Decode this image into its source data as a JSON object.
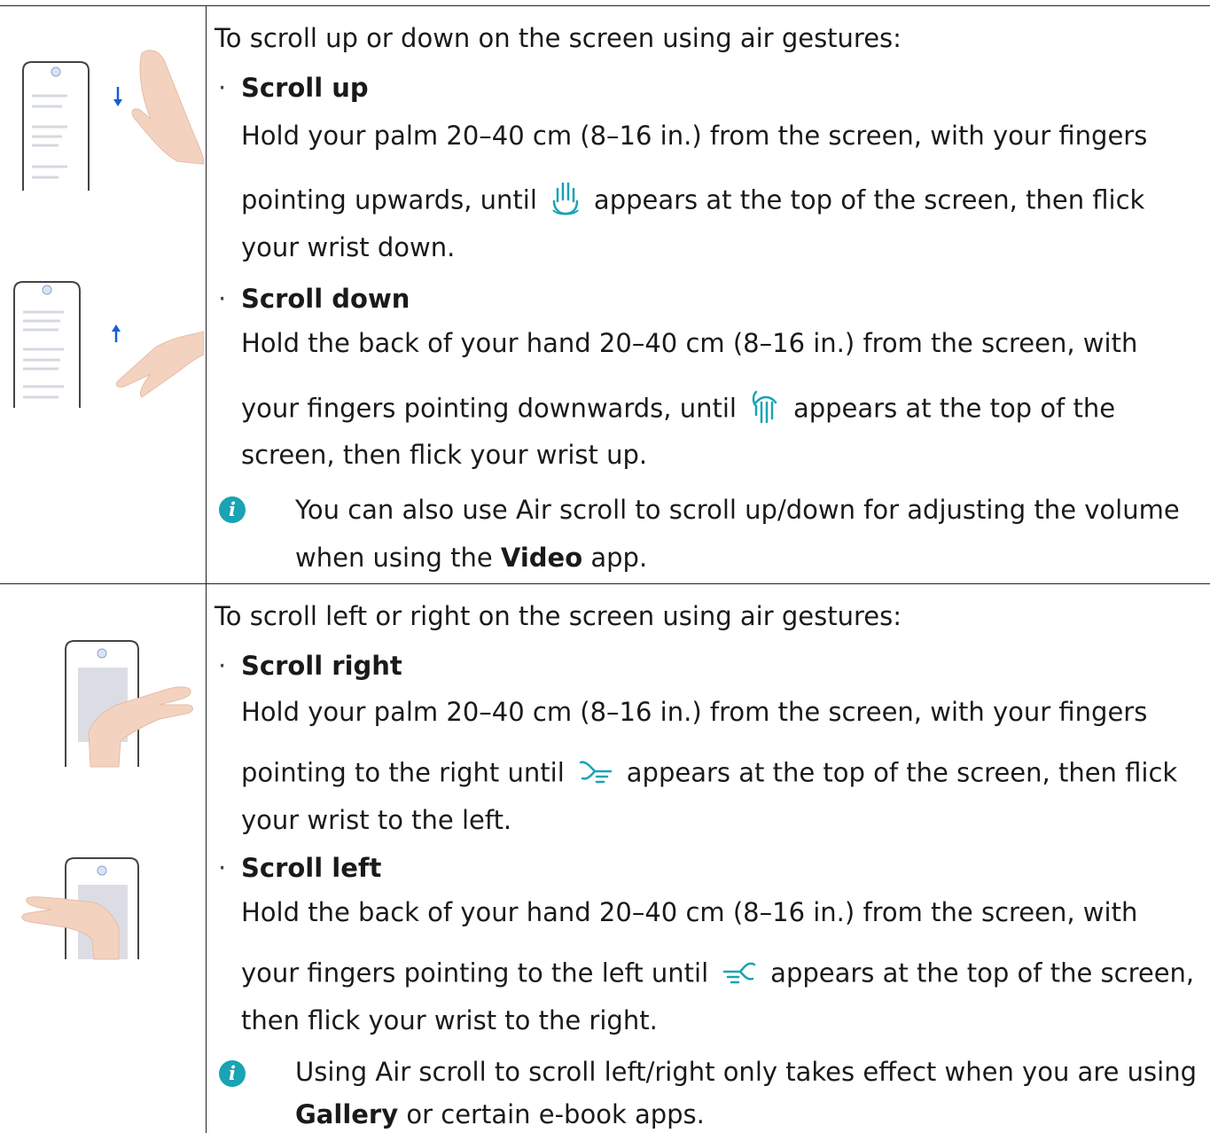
{
  "section1": {
    "intro": "To scroll up or down on the screen using air gestures:",
    "items": [
      {
        "title": "Scroll up",
        "line1": "Hold your palm 20–40 cm (8–16 in.) from the screen, with your fingers",
        "line2_pre": "pointing upwards, until",
        "line2_post": "appears at the top of the screen, then flick",
        "line3": "your wrist down.",
        "icon": "hand-palm-up-icon"
      },
      {
        "title": "Scroll down",
        "line1": "Hold the back of your hand 20–40 cm (8–16 in.) from the screen, with",
        "line2_pre": "your fingers pointing downwards, until",
        "line2_post": "appears at the top of the",
        "line3": "screen, then flick your wrist up.",
        "icon": "hand-back-down-icon"
      }
    ],
    "note": {
      "line1": "You can also use Air scroll to scroll up/down for adjusting the volume",
      "line2_pre": "when using the",
      "line2_bold": "Video",
      "line2_post": "app."
    }
  },
  "section2": {
    "intro": "To scroll left or right on the screen using air gestures:",
    "items": [
      {
        "title": "Scroll right",
        "line1": "Hold your palm 20–40 cm (8–16 in.) from the screen, with your fingers",
        "line2_pre": "pointing to the right until",
        "line2_post": "appears at the top of the screen, then flick",
        "line3": "your wrist to the left.",
        "icon": "hand-point-right-icon"
      },
      {
        "title": "Scroll left",
        "line1": "Hold the back of your hand 20–40 cm (8–16 in.) from the screen, with",
        "line2_pre": "your fingers pointing to the left until",
        "line2_post": "appears at the top of the screen,",
        "line3": "then flick your wrist to the right.",
        "icon": "hand-point-left-icon"
      }
    ],
    "note": {
      "line1": "Using Air scroll to scroll left/right only takes effect when you are using",
      "line2_bold": "Gallery",
      "line2_post": "or certain e-book apps."
    }
  },
  "colors": {
    "accent": "#1aa2b5",
    "arrow": "#1a5bd6",
    "rule": "#222222",
    "skin": "#f3d3c0"
  }
}
